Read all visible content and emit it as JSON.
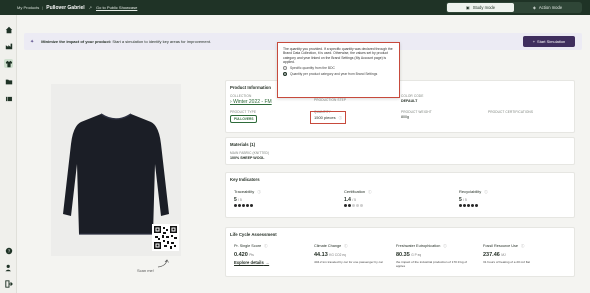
{
  "header": {
    "breadcrumb": "My Products",
    "product_name": "Pullover Gabriel",
    "share_link": "Go to Public Showcase",
    "modes": [
      {
        "label": "Study mode",
        "active": true
      },
      {
        "label": "Action mode",
        "active": false
      }
    ]
  },
  "banner": {
    "bold": "Minimize the impact of your product:",
    "text": "Start a simulation to identify key areas for improvement.",
    "button": "Start Simulation"
  },
  "scan_label": "Scan me!",
  "product_info": {
    "title": "Product Information",
    "collection_label": "COLLECTION",
    "collection_value": "Winter 2022 - FM",
    "product_type_label": "PRODUCT TYPE",
    "product_type_value": "PULLOVERS",
    "quantity_label": "QUANTITY",
    "quantity_value": "1500 pieces",
    "production_label": "PRODUCTION STEP",
    "color_code_label": "COLOR CODE",
    "color_code_value": "DEFAULT",
    "weight_label": "PRODUCT WEIGHT",
    "weight_value": "800g",
    "certifications_label": "PRODUCT CERTIFICATIONS"
  },
  "tooltip": {
    "text": "The quantity you provided. If a specific quantity was declared through the Brand Data Collection, it is used. Otherwise, the values set by product category and year linked on the Brand Settings (My Account page) is applied.",
    "options": [
      {
        "label": "Specific quantity from the BDC",
        "selected": false
      },
      {
        "label": "Quantity per product category and year from Brand Settings",
        "selected": true
      }
    ]
  },
  "materials": {
    "title": "Materials (1)",
    "fabric_label": "MAIN FABRIC (KNITTED)",
    "fabric_value": "100% SHEEP WOOL"
  },
  "key_indicators": {
    "title": "Key Indicators",
    "items": [
      {
        "name": "Traceability",
        "score": "5",
        "max": "/ 5",
        "filled": 5
      },
      {
        "name": "Certification",
        "score": "1.4",
        "max": "/ 5",
        "filled": 2
      },
      {
        "name": "Recyclability",
        "score": "5",
        "max": "/ 5",
        "filled": 5
      }
    ]
  },
  "lca": {
    "title": "Life Cycle Assessment",
    "items": [
      {
        "name": "Pr. Single Score",
        "value": "0.420",
        "unit": "Pts",
        "desc": "",
        "link": "Explore details"
      },
      {
        "name": "Climate Change",
        "value": "44.13",
        "unit": "KG CO2 eq",
        "desc": "404.2 km traveled by car for one passenger by car",
        "link": ""
      },
      {
        "name": "Freshwater Eutrophication",
        "value": "80.35",
        "unit": "G P eq",
        "desc": "the impact of the industrial production of 170.9 kg of apples",
        "link": ""
      },
      {
        "name": "Fossil Resource Use",
        "value": "237.46",
        "unit": "MJ",
        "desc": "31 hours of heating of a 20 m2 flat",
        "link": ""
      }
    ]
  },
  "colors": {
    "brand_dark": "#1f3326",
    "accent_purple": "#3f2e5e",
    "highlight_red": "#c74a3c"
  }
}
